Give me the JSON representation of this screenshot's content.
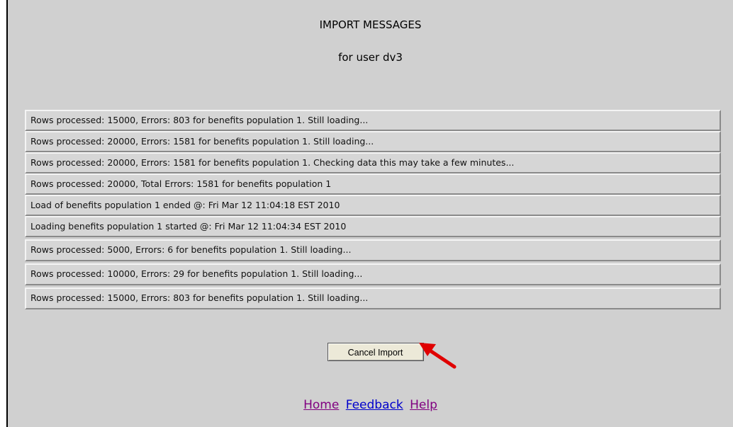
{
  "header": {
    "title": "IMPORT MESSAGES",
    "subtitle": "for user dv3"
  },
  "messages": [
    "Rows processed: 15000, Errors: 803 for benefits population 1. Still loading...",
    "Rows processed: 20000, Errors: 1581 for benefits population 1. Still loading...",
    "Rows processed: 20000, Errors: 1581 for benefits population 1. Checking data this may take a few minutes...",
    "Rows processed: 20000, Total Errors: 1581 for benefits population 1",
    "Load of benefits population 1 ended @: Fri Mar 12 11:04:18 EST 2010",
    "Loading benefits population 1 started @: Fri Mar 12 11:04:34 EST 2010",
    "Rows processed: 5000, Errors: 6 for benefits population 1. Still loading...",
    "Rows processed: 10000, Errors: 29 for benefits population 1. Still loading...",
    "Rows processed: 15000, Errors: 803 for benefits population 1. Still loading..."
  ],
  "actions": {
    "cancel_label": "Cancel Import"
  },
  "footer": {
    "home": "Home",
    "feedback": "Feedback",
    "help": "Help"
  },
  "colors": {
    "panel_bg": "#d0d0d0",
    "visited_link": "#800080",
    "link": "#0000cc",
    "annotation_arrow": "#e00000"
  },
  "icons": {
    "annotation": "red-arrow-icon"
  }
}
